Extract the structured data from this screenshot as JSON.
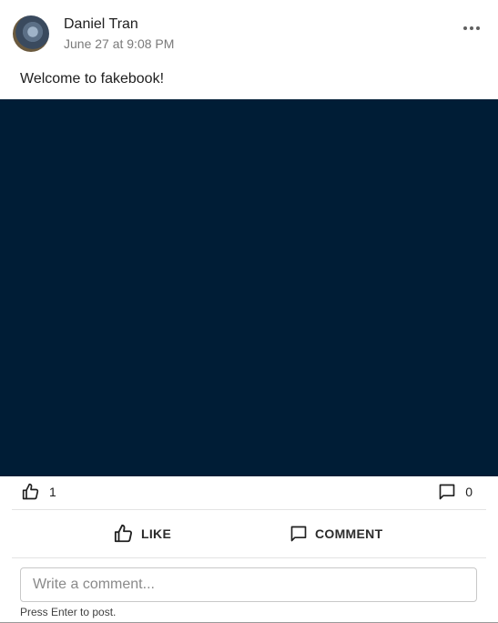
{
  "post": {
    "author": "Daniel Tran",
    "timestamp": "June 27 at 9:08 PM",
    "text": "Welcome to fakebook!",
    "media_color": "#001d36"
  },
  "stats": {
    "likes": "1",
    "comments": "0"
  },
  "actions": {
    "like_label": "LIKE",
    "comment_label": "COMMENT"
  },
  "comment_box": {
    "placeholder": "Write a comment...",
    "hint": "Press Enter to post."
  },
  "icons": {
    "more": "more-horizontal-icon",
    "like": "thumbs-up-icon",
    "comment": "comment-icon"
  }
}
